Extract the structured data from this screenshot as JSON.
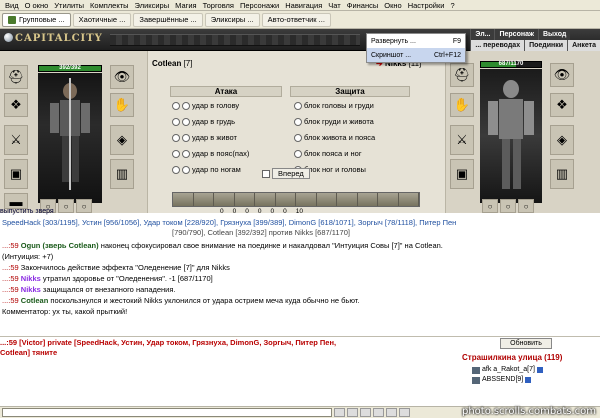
{
  "menubar": {
    "items": [
      "Вид",
      "О окно",
      "Утилиты",
      "Комплекты",
      "Эликсиры",
      "Магия",
      "Торговля",
      "Персонажи",
      "Навигация",
      "Чат",
      "Финансы",
      "Окно",
      "Настройки",
      "?"
    ]
  },
  "tabs": [
    {
      "label": "Групповые ..."
    },
    {
      "label": "Хаотичные ..."
    },
    {
      "label": "Завершённые ..."
    },
    {
      "label": "Эликсиры ..."
    },
    {
      "label": "Авто-ответчик ..."
    }
  ],
  "game_header": {
    "logo": "CAPITALCITY",
    "nav_top": [
      "Эл...",
      "Персонаж",
      "Выход"
    ],
    "nav_bottom": [
      "... переводах",
      "Поединки",
      "Анкета"
    ]
  },
  "dropdown": {
    "items": [
      {
        "label": "Развернуть ...",
        "key": "F9"
      },
      {
        "label": "Скриншот ...",
        "key": "Ctrl+F12"
      }
    ]
  },
  "left_player": {
    "name": "Cotlean",
    "level": "[7]",
    "hp": "392/392",
    "hp_fraction": 1.0
  },
  "right_player": {
    "name": "Nikks",
    "level": "[11]",
    "hp": "687/1170",
    "hp_fraction": 0.587
  },
  "combat": {
    "attack_title": "Атака",
    "defense_title": "Защита",
    "attack": [
      "удар в голову",
      "удар в грудь",
      "удар в живот",
      "удар в пояс(пах)",
      "удар по ногам"
    ],
    "defense": [
      "блок головы и груди",
      "блок груди и живота",
      "блок живота и пояса",
      "блок пояса и ног",
      "блок ног и головы"
    ],
    "forward": "Вперед"
  },
  "stats": [
    "0",
    "0",
    "0",
    "0",
    "0",
    "0",
    "10"
  ],
  "unleash": "выпустить зверя",
  "players_line": {
    "entries": [
      "SpeedHack [303/1195],",
      "Устин [956/1056],",
      "Удар током [228/920],",
      "Грязнуха [399/389],",
      "DimonG [618/1071],",
      "Зоргыч [78/1118],",
      "Питер Пен"
    ],
    "second": "[790/790], Cotlean [392/392] против Nikks [687/1170]"
  },
  "chat": [
    {
      "time": "...:59",
      "nick": "Ogun (зверь Cotlean)",
      "text": "наконец сфокусировал свое внимание на поединке и накалдовал \"Интуиция Совы [7]\" на Cotlean."
    },
    {
      "time": "",
      "nick": "",
      "text": "(Интуиция: +7)"
    },
    {
      "time": "...:59",
      "nick": "",
      "text": "Закончилось действие эффекта \"Оледенение [7]\" для Nikks"
    },
    {
      "time": "...:59",
      "nick": "Nikks",
      "text": "утратил здоровье от \"Оледенения\". -1 [687/1170]"
    },
    {
      "time": "...:59",
      "nick": "Nikks",
      "text": "защищался от внезапного нападения."
    },
    {
      "time": "...:59",
      "nick": "Cotlean",
      "text": "поскользнулся и жестокий Nikks уклонился от удара острием меча куда обычно не бьют."
    },
    {
      "time": "",
      "nick": "",
      "text": "Комментатор: ух ты, какой прыткий!"
    }
  ],
  "private": {
    "line1": "...:59 [Victor] private [SpeedHack, Устин, Удар током, Грязнуха, DimonG, Зоргыч, Питер Пен,",
    "line2": "Cotlean] тяните"
  },
  "refresh": "Обновить",
  "street": "Страшилкина улица (119)",
  "userlist": [
    "afk a_Rakot_a[7]",
    "ABSSEND[9]"
  ],
  "watermark": "photo.scrolls.combats.com"
}
